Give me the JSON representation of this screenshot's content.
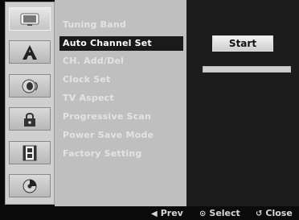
{
  "left_icons": [
    {
      "name": "tv-icon"
    },
    {
      "name": "letter-a-icon"
    },
    {
      "name": "speaker-icon"
    },
    {
      "name": "lock-icon"
    },
    {
      "name": "film-icon"
    },
    {
      "name": "disc-icon"
    }
  ],
  "menu": {
    "items": [
      {
        "label": "Tuning Band"
      },
      {
        "label": "Auto Channel Set"
      },
      {
        "label": "CH. Add/Del"
      },
      {
        "label": "Clock Set"
      },
      {
        "label": "TV Aspect"
      },
      {
        "label": "Progressive Scan"
      },
      {
        "label": "Power Save Mode"
      },
      {
        "label": "Factory Setting"
      }
    ],
    "selected_index": 1
  },
  "panel": {
    "start_label": "Start",
    "progress_percent": 0
  },
  "bottom_hints": {
    "prev_label": "Prev",
    "select_label": "Select",
    "close_label": "Close"
  },
  "colors": {
    "accent": "#3a6fd8",
    "menu_bg": "#bfbfbf",
    "panel_bg": "#1c1c1c"
  }
}
